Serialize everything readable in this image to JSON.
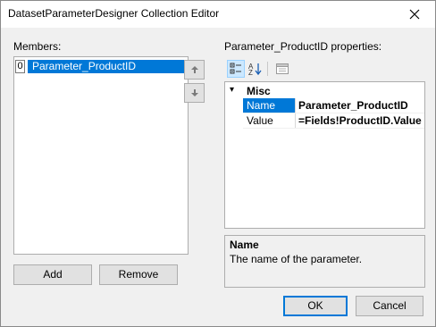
{
  "window": {
    "title": "DatasetParameterDesigner Collection Editor"
  },
  "members": {
    "label": "Members:",
    "items": [
      {
        "index": "0",
        "name": "Parameter_ProductID"
      }
    ],
    "add_label": "Add",
    "remove_label": "Remove"
  },
  "properties": {
    "label": "Parameter_ProductID properties:",
    "category": "Misc",
    "rows": [
      {
        "name": "Name",
        "value": "Parameter_ProductID"
      },
      {
        "name": "Value",
        "value": "=Fields!ProductID.Value"
      }
    ],
    "description_title": "Name",
    "description_text": "The name of the parameter."
  },
  "footer": {
    "ok_label": "OK",
    "cancel_label": "Cancel"
  },
  "colors": {
    "selection": "#0078d7",
    "background": "#f0f0f0"
  }
}
